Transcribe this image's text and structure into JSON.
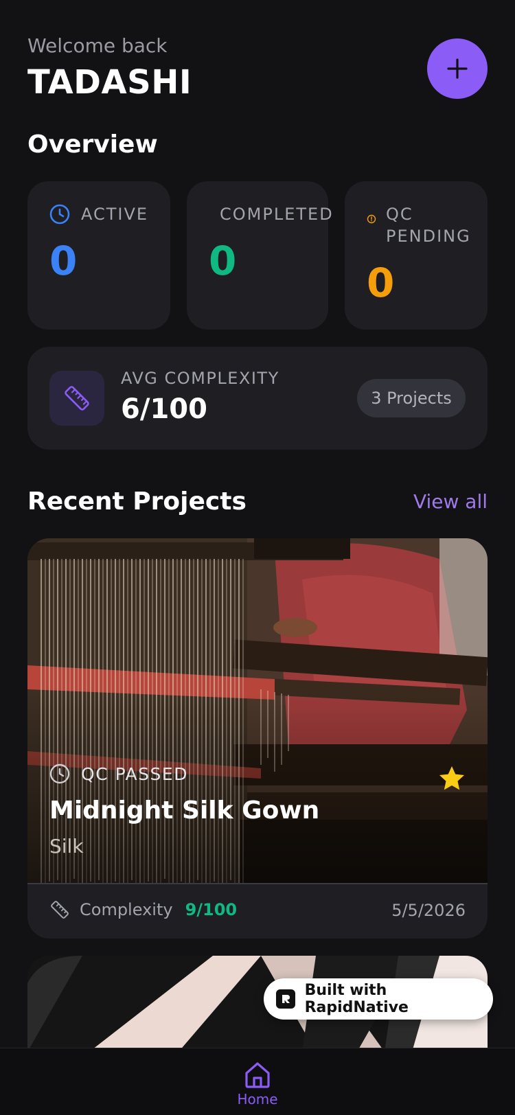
{
  "header": {
    "greeting": "Welcome back",
    "user_name": "TADASHI"
  },
  "overview": {
    "title": "Overview",
    "stats": [
      {
        "label": "ACTIVE",
        "value": "0",
        "color": "#3b82f6",
        "icon": "clock-icon"
      },
      {
        "label": "COMPLETED",
        "value": "0",
        "color": "#10b981",
        "icon": ""
      },
      {
        "label_line1": "QC",
        "label_line2": "PENDING",
        "value": "0",
        "color": "#f59e0b",
        "icon": "alert-circle-icon"
      }
    ],
    "complexity": {
      "label": "AVG COMPLEXITY",
      "value": "6/100",
      "projects": "3 Projects"
    }
  },
  "recent": {
    "title": "Recent Projects",
    "view_all": "View all",
    "projects": [
      {
        "status": "QC PASSED",
        "name": "Midnight Silk Gown",
        "material": "Silk",
        "complexity_label": "Complexity",
        "complexity_value": "9/100",
        "date": "5/5/2026",
        "favorite": true
      }
    ]
  },
  "badge": {
    "text": "Built with RapidNative"
  },
  "nav": {
    "home_label": "Home"
  },
  "colors": {
    "accent": "#8b5cf6",
    "active": "#3b82f6",
    "completed": "#10b981",
    "pending": "#f59e0b",
    "star": "#facc15"
  }
}
